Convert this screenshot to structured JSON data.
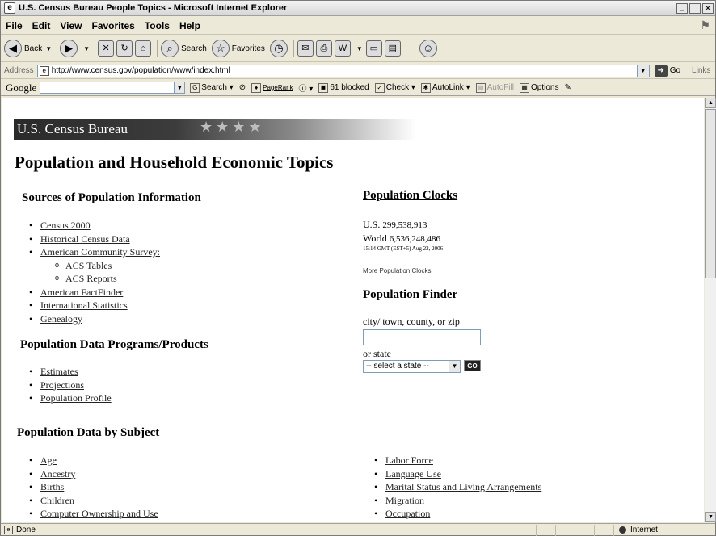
{
  "window": {
    "title": "U.S. Census Bureau People Topics - Microsoft Internet Explorer"
  },
  "menu": [
    "File",
    "Edit",
    "View",
    "Favorites",
    "Tools",
    "Help"
  ],
  "toolbar": {
    "back": "Back",
    "search": "Search",
    "favorites": "Favorites"
  },
  "address": {
    "label": "Address",
    "url": "http://www.census.gov/population/www/index.html",
    "go": "Go",
    "links": "Links"
  },
  "google_bar": {
    "logo": "Google",
    "search": "Search",
    "pagerank": "PageRank",
    "blocked": "61 blocked",
    "check": "Check",
    "autolink": "AutoLink",
    "autofill": "AutoFill",
    "options": "Options"
  },
  "page": {
    "banner": "U.S. Census Bureau",
    "title": "Population and Household Economic Topics",
    "sources": {
      "heading": "Sources of Population Information",
      "items": [
        "Census 2000",
        "Historical Census Data",
        "American Community Survey:",
        "ACS Tables",
        "ACS Reports",
        "American FactFinder",
        "International Statistics",
        "Genealogy"
      ]
    },
    "programs": {
      "heading": "Population Data Programs/Products",
      "items": [
        "Estimates",
        "Projections",
        "Population Profile"
      ]
    },
    "by_subject": {
      "heading": "Population Data by Subject",
      "left_items": [
        "Age",
        "Ancestry",
        "Births",
        "Children",
        "Computer Ownership and Use"
      ],
      "right_items": [
        "Labor Force",
        "Language Use",
        "Marital Status and Living Arrangements",
        "Migration",
        "Occupation"
      ]
    },
    "clocks": {
      "heading": "Population Clocks",
      "us_label": "U.S.",
      "us_value": "299,538,913",
      "world_label": "World",
      "world_value": "6,536,248,486",
      "timestamp": "15:14 GMT (EST+5) Aug 22, 2006",
      "more": "More Population Clocks"
    },
    "finder": {
      "heading": "Population Finder",
      "city_label": "city/ town, county, or zip",
      "city_value": "",
      "state_label": "or state",
      "state_selected": "-- select a state --",
      "go": "GO"
    }
  },
  "status": {
    "text": "Done",
    "zone": "Internet"
  }
}
